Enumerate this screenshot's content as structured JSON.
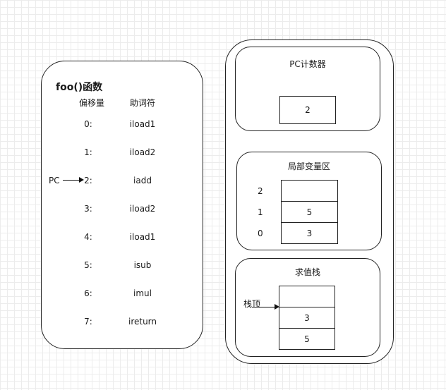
{
  "function_panel": {
    "title": "foo()函数",
    "col_offset": "偏移量",
    "col_mnemonic": "助词符",
    "rows": [
      {
        "offset": "0:",
        "instr": "iload1"
      },
      {
        "offset": "1:",
        "instr": "iload2"
      },
      {
        "offset": "2:",
        "instr": "iadd"
      },
      {
        "offset": "3:",
        "instr": "iload2"
      },
      {
        "offset": "4:",
        "instr": "iload1"
      },
      {
        "offset": "5:",
        "instr": "isub"
      },
      {
        "offset": "6:",
        "instr": "imul"
      },
      {
        "offset": "7:",
        "instr": "ireturn"
      }
    ],
    "pc_label": "PC"
  },
  "pc_counter": {
    "title": "PC计数器",
    "value": "2"
  },
  "local_vars": {
    "title": "局部变量区",
    "slots": [
      {
        "index": "2",
        "value": ""
      },
      {
        "index": "1",
        "value": "5"
      },
      {
        "index": "0",
        "value": "3"
      }
    ]
  },
  "operand_stack": {
    "title": "求值栈",
    "top_label": "栈顶",
    "cells": [
      "",
      "3",
      "5"
    ]
  }
}
